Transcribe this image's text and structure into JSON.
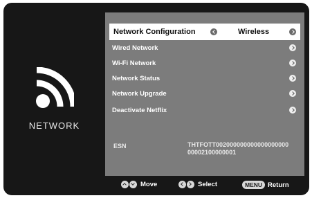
{
  "sidebar": {
    "title": "NETWORK",
    "icon": "wifi-icon"
  },
  "menu": {
    "items": [
      {
        "label": "Network Configuration",
        "value": "Wireless",
        "selected": true
      },
      {
        "label": "Wired Network"
      },
      {
        "label": "Wi-Fi Network"
      },
      {
        "label": "Network Status"
      },
      {
        "label": "Network Upgrade"
      },
      {
        "label": "Deactivate Netflix"
      }
    ]
  },
  "esn": {
    "label": "ESN",
    "value": "THTFOTT00200000000000000000000002100000001"
  },
  "footer": {
    "move_label": "Move",
    "select_label": "Select",
    "menu_key": "MENU",
    "return_label": "Return"
  },
  "colors": {
    "panel": "#7c7c7c",
    "background": "#171717",
    "selected_row": "#ffffff"
  }
}
